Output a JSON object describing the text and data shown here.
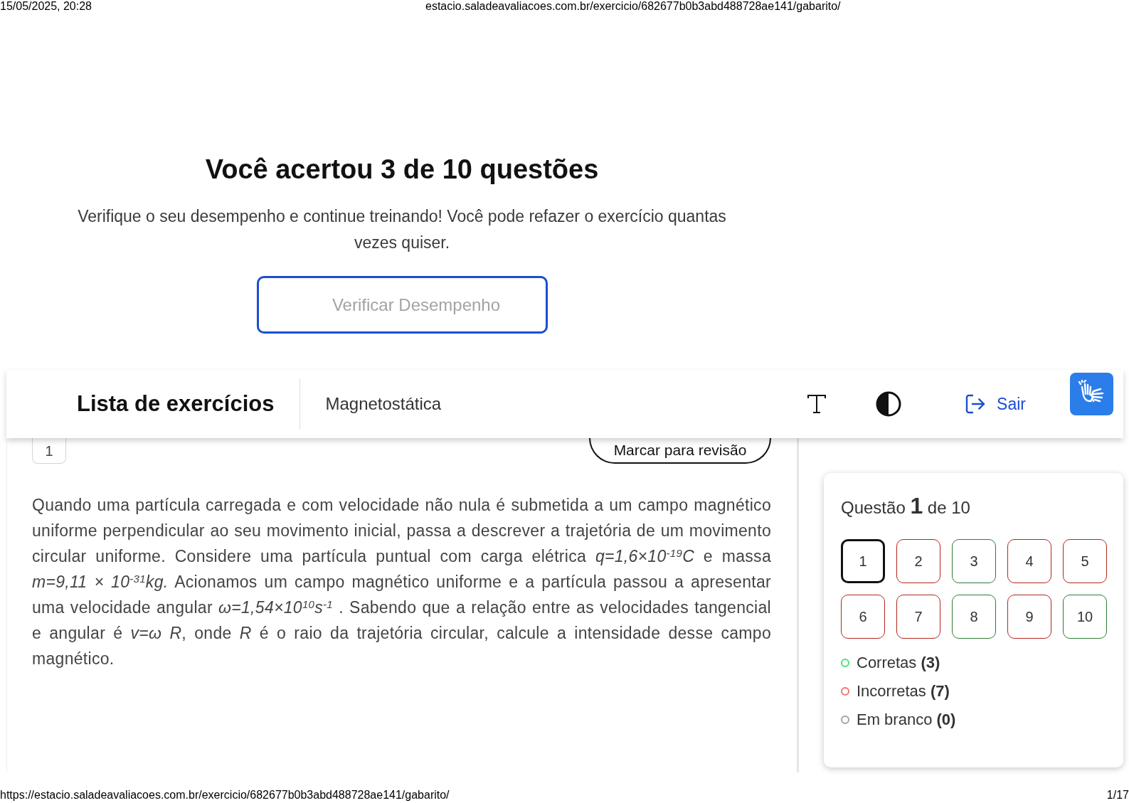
{
  "print_header": {
    "date": "15/05/2025, 20:28",
    "url": "estacio.saladeavaliacoes.com.br/exercicio/682677b0b3abd488728ae141/gabarito/"
  },
  "result": {
    "title": "Você acertou 3 de 10 questões",
    "message": "Verifique o seu desempenho e continue treinando! Você pode refazer o exercício quantas vezes quiser.",
    "button": "Verificar Desempenho"
  },
  "navbar": {
    "title": "Lista de exercícios",
    "subject": "Magnetostática",
    "exit": "Sair"
  },
  "question": {
    "number": "1",
    "review_button": "Marcar para revisão",
    "text": "Quando uma partícula carregada e com velocidade não nula é submetida a um campo magnético uniforme perpendicular ao seu movimento inicial, passa a descrever a trajetória de um movimento circular uniforme. Considere uma partícula puntual com carga elétrica *q=1,6×10*$^{-19}$*C*  e massa *m=9,11 × 10*$^{-31}$*kg.*  Acionamos um campo magnético uniforme e a partícula passou a apresentar uma velocidade angular *ω=1,54×10*$^{10}$*s*$^{-1}$ . Sabendo que a relação entre as velocidades tangencial e angular é *v=ω R*, onde *R* é o raio da trajetória circular, calcule a intensidade desse campo magnético."
  },
  "sidebar": {
    "heading": "Questão **1** de 10",
    "questions": [
      {
        "label": "1",
        "selected": true
      },
      {
        "label": "2",
        "selected": false,
        "color": "#b3261e"
      },
      {
        "label": "3",
        "selected": false,
        "color": "#2e7d32"
      },
      {
        "label": "4",
        "selected": false,
        "color": "#b3261e"
      },
      {
        "label": "5",
        "selected": false,
        "color": "#b3261e"
      },
      {
        "label": "6",
        "selected": false,
        "color": "#b3261e"
      },
      {
        "label": "7",
        "selected": false,
        "color": "#b3261e"
      },
      {
        "label": "8",
        "selected": false,
        "color": "#2e7d32"
      },
      {
        "label": "9",
        "selected": false,
        "color": "#b3261e"
      },
      {
        "label": "10",
        "selected": false,
        "color": "#2e7d32"
      }
    ],
    "legend": [
      {
        "text": "Corretas **(3)**",
        "color": "#4ade80"
      },
      {
        "text": "Incorretas **(7)**",
        "color": "#f87171"
      },
      {
        "text": "Em branco **(0)**",
        "color": "#9ca3af"
      }
    ]
  },
  "print_footer": {
    "url": "https://estacio.saladeavaliacoes.com.br/exercicio/682677b0b3abd488728ae141/gabarito/",
    "page": "1/17"
  }
}
